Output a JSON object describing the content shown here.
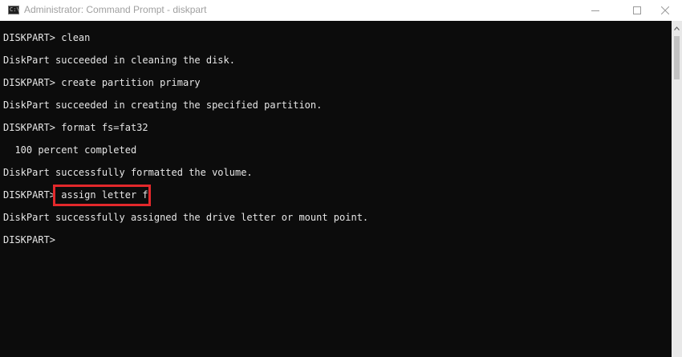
{
  "window": {
    "title": "Administrator: Command Prompt - diskpart",
    "app_icon_glyph": "C:\\"
  },
  "icons": {
    "app": "cmd-icon",
    "minimize": "minimize-icon",
    "maximize": "maximize-icon",
    "close": "close-icon",
    "scroll_up": "chevron-up-icon"
  },
  "colors": {
    "console_background": "#0c0c0c",
    "console_text": "#e6e6e6",
    "highlight": "#e3282b"
  },
  "console": {
    "lines": [
      "DISKPART> clean",
      "DiskPart succeeded in cleaning the disk.",
      "DISKPART> create partition primary",
      "DiskPart succeeded in creating the specified partition.",
      "DISKPART> format fs=fat32",
      "  100 percent completed",
      "DiskPart successfully formatted the volume.",
      "DISKPART> assign letter f",
      "DiskPart successfully assigned the drive letter or mount point.",
      "DISKPART>"
    ]
  }
}
